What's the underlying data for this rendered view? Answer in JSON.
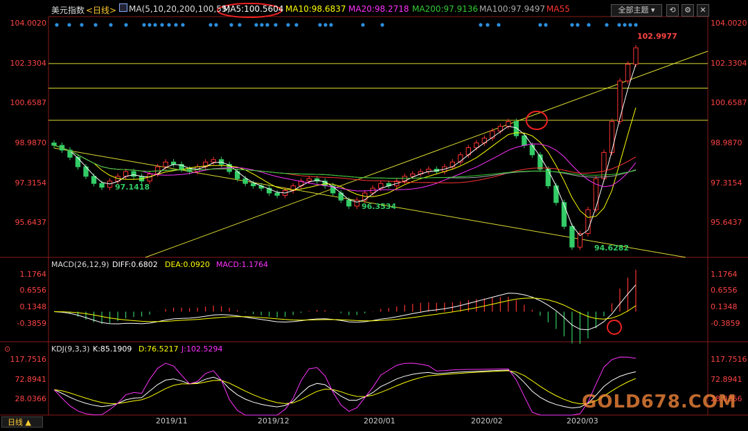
{
  "header": {
    "symbol": "美元指数",
    "period": "<日线>",
    "ma_params": "MA(5,10,20,200,100,55)",
    "ma5": "MA5:100.5604",
    "ma10": "MA10:98.6837",
    "ma20": "MA20:98.2718",
    "ma200": "MA200:97.9136",
    "ma100": "MA100:97.9497",
    "ma55": "MA55",
    "theme_button": "全部主题",
    "colors": {
      "ma5": "#ffffff",
      "ma10": "#ffff00",
      "ma20": "#ff33ff",
      "ma200": "#33cc33",
      "ma100": "#aaaaaa",
      "ma55": "#ff3333"
    }
  },
  "price_axis": {
    "labels": [
      "104.0020",
      "102.3304",
      "100.6587",
      "98.9870",
      "97.3154",
      "95.6437"
    ]
  },
  "annotations": {
    "high": "102.9977",
    "low1": "97.1418",
    "low2": "96.3534",
    "low3": "94.6282"
  },
  "macd": {
    "title": "MACD(26,12,9)",
    "diff": "DIFF:0.6802",
    "dea": "DEA:0.0920",
    "macd": "MACD:1.1764",
    "axis": [
      "1.1764",
      "0.6556",
      "0.1348",
      "-0.3859"
    ]
  },
  "kdj": {
    "title": "KDJ(9,3,3)",
    "k": "K:85.1909",
    "d": "D:76.5217",
    "j": "J:102.5294",
    "axis": [
      "117.7516",
      "72.8941",
      "28.0366"
    ]
  },
  "time_axis": {
    "labels": [
      "2019/11",
      "2019/12",
      "2020/01",
      "2020/02",
      "2020/03"
    ]
  },
  "bottom": {
    "tab": "日线 ▲"
  },
  "watermark": "GOLD678.COM",
  "chart_data": {
    "type": "candlestick",
    "title": "美元指数",
    "ylim": [
      94.2,
      104.3
    ],
    "x_range_labels": [
      "2019/11",
      "2019/12",
      "2020/01",
      "2020/02",
      "2020/03"
    ],
    "close_path": [
      98.9,
      98.7,
      98.4,
      98.0,
      97.6,
      97.3,
      97.14,
      97.4,
      97.6,
      97.8,
      97.6,
      97.4,
      97.7,
      98.0,
      98.2,
      98.1,
      97.9,
      97.8,
      98.0,
      98.2,
      98.3,
      98.1,
      97.8,
      97.5,
      97.3,
      97.2,
      97.1,
      96.9,
      96.8,
      97.0,
      97.2,
      97.4,
      97.5,
      97.4,
      97.2,
      96.9,
      96.6,
      96.35,
      96.6,
      96.9,
      97.1,
      97.3,
      97.2,
      97.4,
      97.6,
      97.7,
      97.8,
      97.9,
      97.8,
      98.0,
      98.2,
      98.5,
      98.8,
      99.0,
      99.2,
      99.5,
      99.7,
      99.9,
      99.3,
      98.9,
      98.5,
      97.9,
      97.2,
      96.5,
      95.5,
      94.63,
      95.2,
      96.2,
      97.5,
      98.6,
      99.9,
      101.6,
      102.3,
      102.99
    ],
    "macd_scale": [
      -0.95,
      1.45
    ],
    "kdj_scale": [
      -8,
      140
    ]
  }
}
